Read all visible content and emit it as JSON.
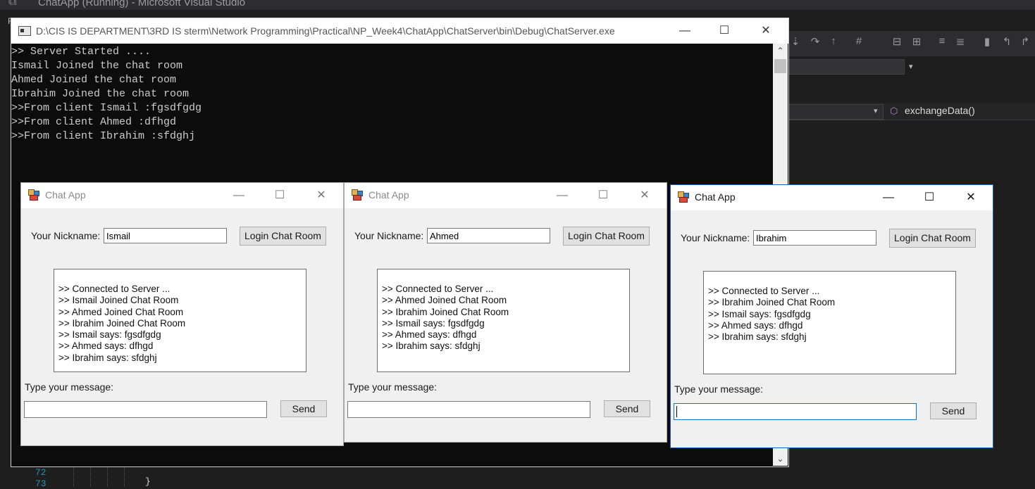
{
  "vs": {
    "title": "ChatApp (Running) - Microsoft Visual Studio",
    "left_char": "F",
    "nav_method": "exchangeData()",
    "line_numbers": [
      "72",
      "73"
    ],
    "code_brace": "}"
  },
  "console": {
    "title": "D:\\CIS IS DEPARTMENT\\3RD IS sterm\\Network Programming\\Practical\\NP_Week4\\ChatApp\\ChatServer\\bin\\Debug\\ChatServer.exe",
    "lines": [
      ">> Server Started ....",
      "Ismail Joined the chat room",
      "Ahmed Joined the chat room",
      "Ibrahim Joined the chat room",
      ">>From client Ismail :fgsdfgdg",
      ">>From client Ahmed :dfhgd",
      ">>From client Ibrahim :sfdghj"
    ]
  },
  "chats": [
    {
      "title": "Chat App",
      "nickname_label": "Your Nickname:",
      "nickname": "Ismail",
      "login_label": "Login Chat Room",
      "messages": [
        ">> Connected to Server ...",
        ">> Ismail Joined Chat Room",
        ">> Ahmed Joined Chat Room",
        ">> Ibrahim Joined Chat Room",
        ">> Ismail says: fgsdfgdg",
        ">> Ahmed says: dfhgd",
        ">> Ibrahim says: sfdghj"
      ],
      "type_label": "Type your message:",
      "send_label": "Send"
    },
    {
      "title": "Chat App",
      "nickname_label": "Your Nickname:",
      "nickname": "Ahmed",
      "login_label": "Login Chat Room",
      "messages": [
        ">> Connected to Server ...",
        ">> Ahmed Joined Chat Room",
        ">> Ibrahim Joined Chat Room",
        ">> Ismail says: fgsdfgdg",
        ">> Ahmed says: dfhgd",
        ">> Ibrahim says: sfdghj"
      ],
      "type_label": "Type your message:",
      "send_label": "Send"
    },
    {
      "title": "Chat App",
      "nickname_label": "Your Nickname:",
      "nickname": "Ibrahim",
      "login_label": "Login Chat Room",
      "messages": [
        ">> Connected to Server ...",
        ">> Ibrahim Joined Chat Room",
        ">> Ismail says: fgsdfgdg",
        ">> Ahmed says: dfhgd",
        ">> Ibrahim says: sfdghj"
      ],
      "type_label": "Type your message:",
      "send_label": "Send"
    }
  ],
  "captions": {
    "minimize": "—",
    "maximize": "☐",
    "close": "✕"
  }
}
